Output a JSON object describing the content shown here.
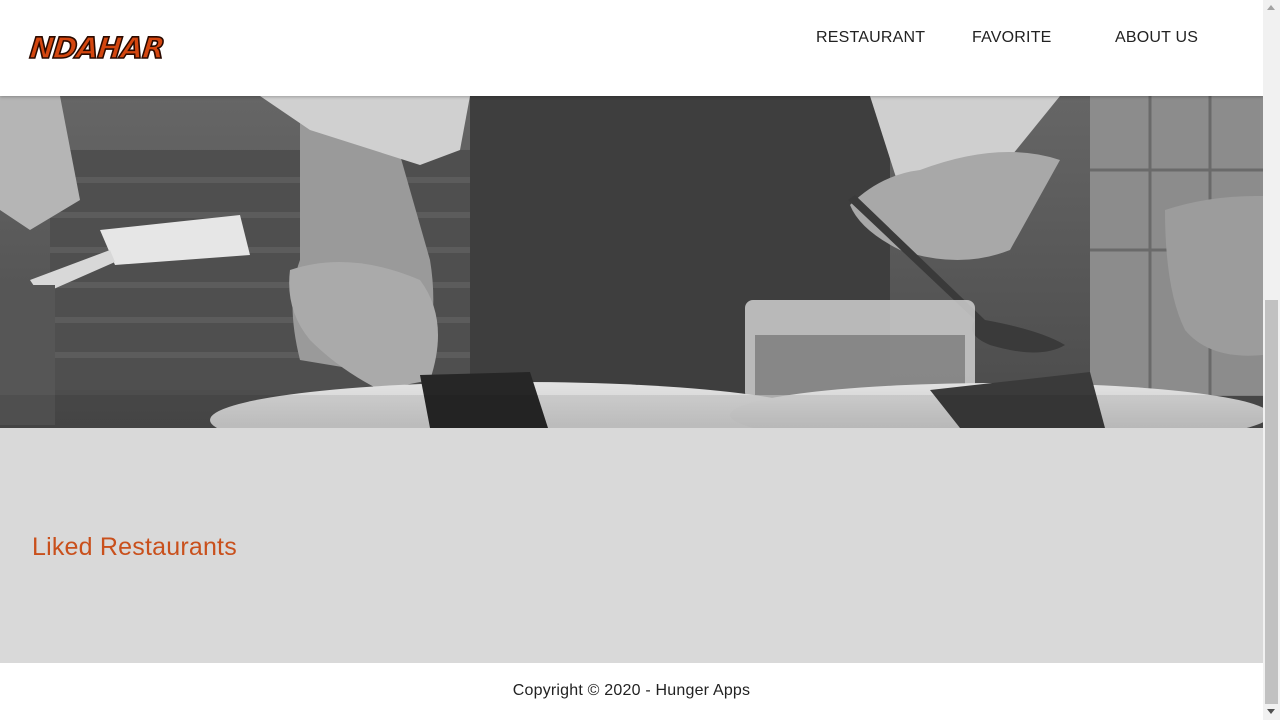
{
  "header": {
    "logo_text": "NDAHAR",
    "nav": [
      {
        "label": "RESTAURANT"
      },
      {
        "label": "FAVORITE"
      },
      {
        "label": "ABOUT US"
      }
    ]
  },
  "hero": {
    "image": "grayscale-chefs-plating-food-photo"
  },
  "main": {
    "title": "Liked Restaurants"
  },
  "footer": {
    "copyright": "Copyright © 2020 - Hunger Apps"
  },
  "colors": {
    "accent": "#c9501c",
    "logo": "#d4460f",
    "content_bg": "#d9d9d9",
    "header_bg": "#ffffff"
  }
}
